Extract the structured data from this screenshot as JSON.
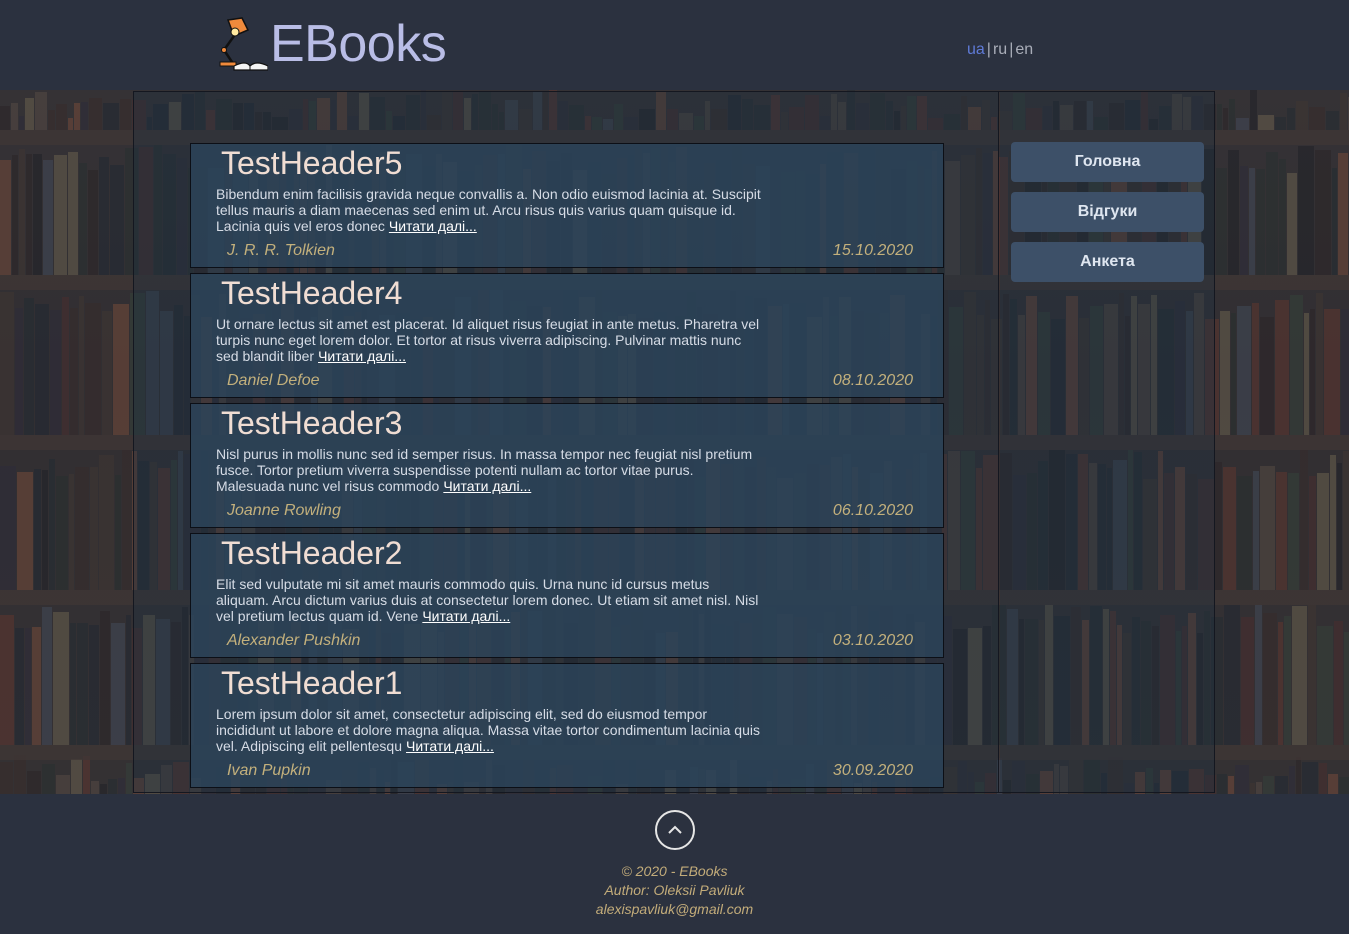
{
  "header": {
    "logo_text": "EBooks",
    "languages": [
      "ua",
      "ru",
      "en"
    ],
    "active_language": "ua"
  },
  "posts": [
    {
      "title": "TestHeader5",
      "text": "Bibendum enim facilisis gravida neque convallis a. Non odio euismod lacinia at. Suscipit tellus mauris a diam maecenas sed enim ut. Arcu risus quis varius quam quisque id. Lacinia quis vel eros donec",
      "link": "Читати далі...",
      "author": "J. R. R. Tolkien",
      "date": "15.10.2020"
    },
    {
      "title": "TestHeader4",
      "text": "Ut ornare lectus sit amet est placerat. Id aliquet risus feugiat in ante metus. Pharetra vel turpis nunc eget lorem dolor. Et tortor at risus viverra adipiscing. Pulvinar mattis nunc sed blandit liber",
      "link": "Читати далі...",
      "author": "Daniel Defoe",
      "date": "08.10.2020"
    },
    {
      "title": "TestHeader3",
      "text": "Nisl purus in mollis nunc sed id semper risus. In massa tempor nec feugiat nisl pretium fusce. Tortor pretium viverra suspendisse potenti nullam ac tortor vitae purus. Malesuada nunc vel risus commodo",
      "link": "Читати далі...",
      "author": "Joanne Rowling",
      "date": "06.10.2020"
    },
    {
      "title": "TestHeader2",
      "text": "Elit sed vulputate mi sit amet mauris commodo quis. Urna nunc id cursus metus aliquam. Arcu dictum varius duis at consectetur lorem donec. Ut etiam sit amet nisl. Nisl vel pretium lectus quam id. Vene",
      "link": "Читати далі...",
      "author": "Alexander Pushkin",
      "date": "03.10.2020"
    },
    {
      "title": "TestHeader1",
      "text": "Lorem ipsum dolor sit amet, consectetur adipiscing elit, sed do eiusmod tempor incididunt ut labore et dolore magna aliqua. Massa vitae tortor condimentum lacinia quis vel. Adipiscing elit pellentesqu",
      "link": "Читати далі...",
      "author": "Ivan Pupkin",
      "date": "30.09.2020"
    }
  ],
  "nav": {
    "home": "Головна",
    "reviews": "Відгуки",
    "survey": "Анкета"
  },
  "footer": {
    "copyright": "© 2020 - EBooks",
    "author": "Author: Oleksii Pavliuk",
    "email": "alexispavliuk@gmail.com"
  },
  "colors": {
    "background": "#2b313f",
    "logo": "#b9bde6",
    "post_title": "#f0ddd3",
    "meta": "#c3b07c",
    "nav_button": "#3d5068",
    "active_language": "#5f7ad6"
  }
}
